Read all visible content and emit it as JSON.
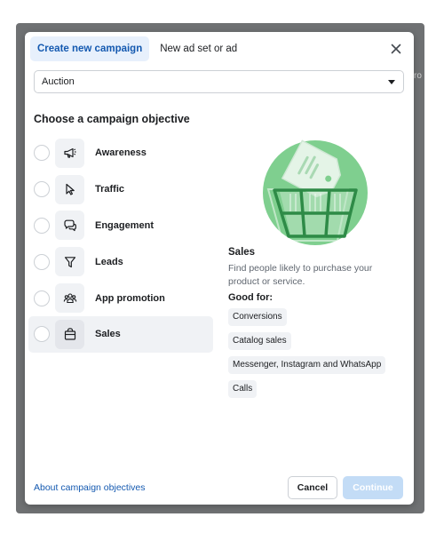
{
  "tabs": [
    {
      "label": "Create new campaign",
      "active": true
    },
    {
      "label": "New ad set or ad",
      "active": false
    }
  ],
  "buying_type": {
    "value": "Auction"
  },
  "objective_heading": "Choose a campaign objective",
  "objectives": [
    {
      "label": "Awareness",
      "icon": "megaphone-icon",
      "selected": false
    },
    {
      "label": "Traffic",
      "icon": "cursor-icon",
      "selected": false
    },
    {
      "label": "Engagement",
      "icon": "chat-bubbles-icon",
      "selected": false
    },
    {
      "label": "Leads",
      "icon": "funnel-icon",
      "selected": false
    },
    {
      "label": "App promotion",
      "icon": "people-icon",
      "selected": false
    },
    {
      "label": "Sales",
      "icon": "shopping-bag-icon",
      "selected": true
    }
  ],
  "detail": {
    "title": "Sales",
    "description": "Find people likely to purchase your product or service.",
    "good_for_label": "Good for:",
    "chips": [
      "Conversions",
      "Catalog sales",
      "Messenger, Instagram and WhatsApp",
      "Calls"
    ]
  },
  "footer": {
    "about_link": "About campaign objectives",
    "cancel_label": "Cancel",
    "continue_label": "Continue"
  },
  "colors": {
    "accent": "#1459b0",
    "illustration_green": "#7fcf8f",
    "continue_disabled": "#c3dcf6"
  }
}
